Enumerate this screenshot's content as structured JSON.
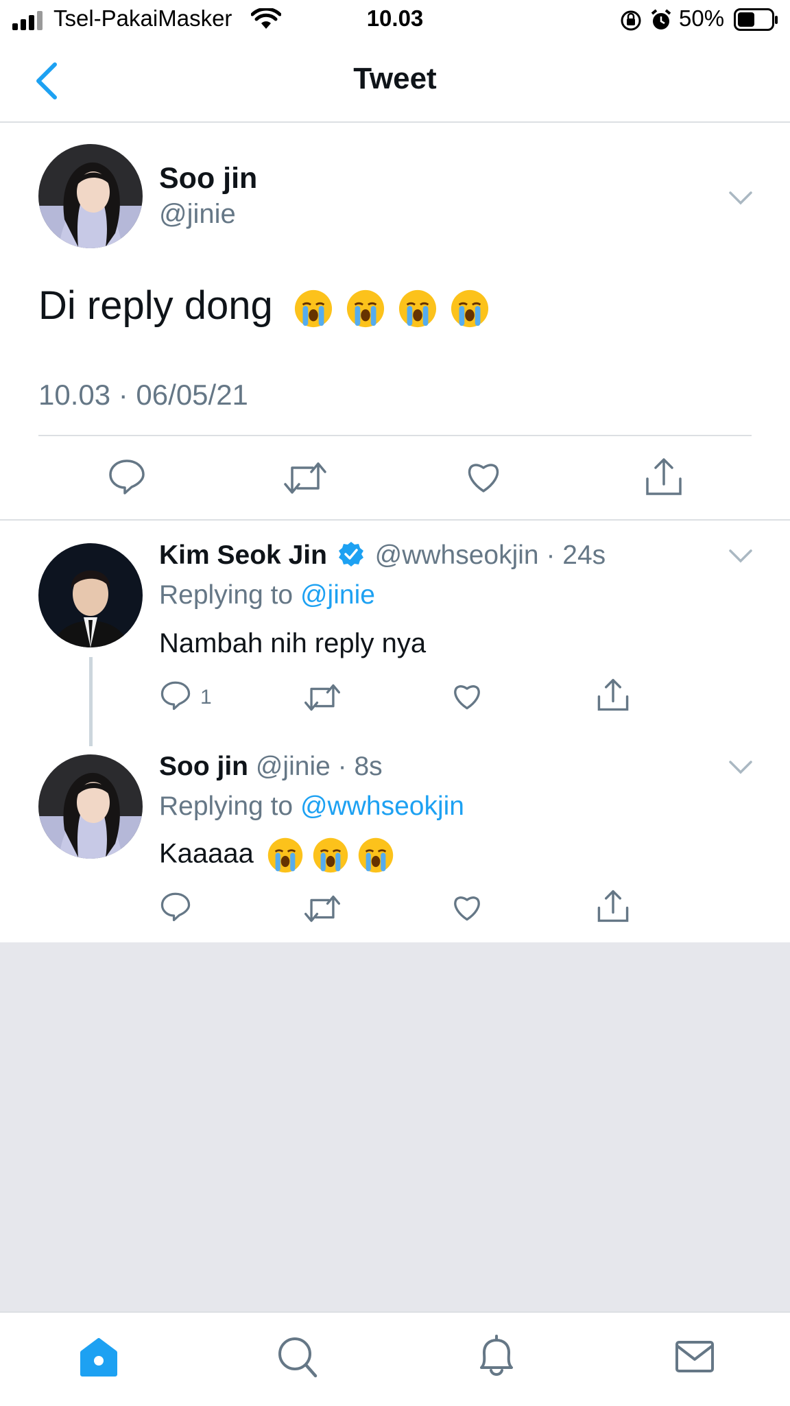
{
  "status_bar": {
    "carrier": "Tsel-PakaiMasker",
    "time": "10.03",
    "battery": "50%"
  },
  "nav": {
    "title": "Tweet"
  },
  "main_tweet": {
    "name": "Soo jin",
    "handle": "@jinie",
    "text": "Di reply dong",
    "emoji_count_note": "",
    "timestamp": "10.03 · 06/05/21"
  },
  "replies": [
    {
      "name": "Kim Seok Jin",
      "handle": "@wwhseokjin",
      "time": "24s",
      "replying_prefix": "Replying to",
      "replying_to": "@jinie",
      "text": "Nambah nih reply nya",
      "reply_count": "1",
      "verified": true
    },
    {
      "name": "Soo jin",
      "handle": "@jinie",
      "time": "8s",
      "replying_prefix": "Replying to",
      "replying_to": "@wwhseokjin",
      "text": "Kaaaaa",
      "verified": false
    }
  ],
  "colors": {
    "accent": "#1da1f2",
    "muted": "#657786",
    "background_gray": "#e6e7ec"
  }
}
